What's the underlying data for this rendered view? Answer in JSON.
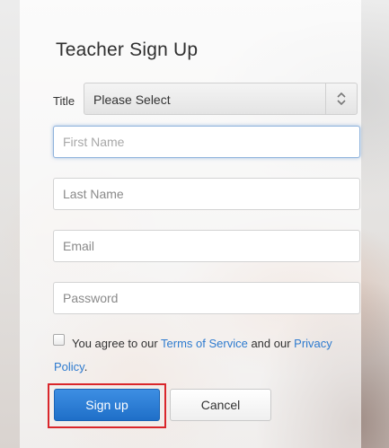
{
  "form": {
    "heading": "Teacher Sign Up",
    "title_label": "Title",
    "title_select": {
      "value": "Please Select"
    },
    "fields": {
      "first_name_placeholder": "First Name",
      "last_name_placeholder": "Last Name",
      "email_placeholder": "Email",
      "password_placeholder": "Password"
    },
    "agreement": {
      "prefix": "You agree to our ",
      "terms_link": "Terms of Service",
      "middle": " and our ",
      "privacy_link": "Privacy Policy",
      "suffix": "."
    },
    "buttons": {
      "signup_label": "Sign up",
      "cancel_label": "Cancel"
    }
  },
  "colors": {
    "primary_button": "#2a7dd6",
    "link": "#2e7bcf",
    "highlight_box": "#d9262b",
    "focus_ring": "#8fb3dc"
  },
  "icons": {
    "select_arrows": "up-down-chevron-icon"
  }
}
